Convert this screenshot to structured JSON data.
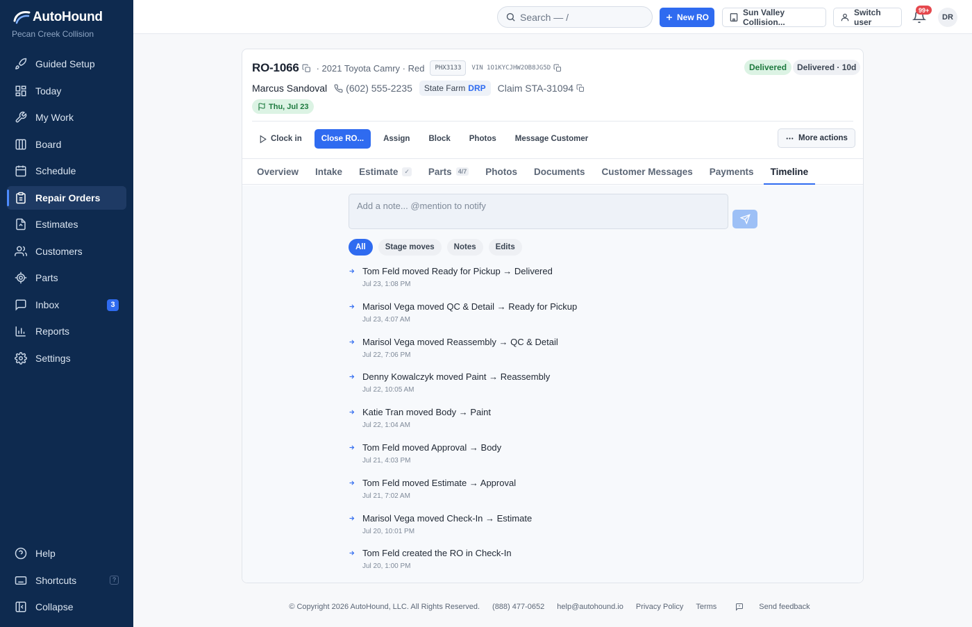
{
  "brand": {
    "name": "AutoHound",
    "shop": "Pecan Creek Collision"
  },
  "nav": {
    "items": [
      {
        "label": "Guided Setup",
        "icon": "rocket-icon"
      },
      {
        "label": "Today",
        "icon": "grid-icon"
      },
      {
        "label": "My Work",
        "icon": "wrench-icon"
      },
      {
        "label": "Board",
        "icon": "columns-icon"
      },
      {
        "label": "Schedule",
        "icon": "calendar-icon"
      },
      {
        "label": "Repair Orders",
        "icon": "clipboard-icon",
        "active": true
      },
      {
        "label": "Estimates",
        "icon": "file-icon"
      },
      {
        "label": "Customers",
        "icon": "users-icon"
      },
      {
        "label": "Parts",
        "icon": "cog-icon"
      },
      {
        "label": "Inbox",
        "icon": "inbox-icon",
        "badge": "3"
      },
      {
        "label": "Reports",
        "icon": "bar-chart-icon"
      },
      {
        "label": "Settings",
        "icon": "gear-icon"
      }
    ],
    "bottom": [
      {
        "label": "Help",
        "icon": "help-icon"
      },
      {
        "label": "Shortcuts",
        "icon": "keyboard-icon",
        "hint": "?"
      },
      {
        "label": "Collapse",
        "icon": "collapse-icon"
      }
    ]
  },
  "topbar": {
    "search_placeholder": "Search — /",
    "new_ro": "New RO",
    "location": "Sun Valley Collision...",
    "switch_user": "Switch user",
    "notifications": "99+",
    "avatar": "DR"
  },
  "ro": {
    "number": "RO-1066",
    "vehicle": "· 2021 Toyota Camry · Red",
    "plate": "PHX3133",
    "vin": "VIN 1O1KYCJHW2OB8JG5D",
    "status": "Delivered",
    "status_age": "Delivered · 10d",
    "customer": "Marcus Sandoval",
    "phone": "(602) 555-2235",
    "insurer": "State Farm",
    "insurer_tag": "DRP",
    "claim": "Claim STA-31094",
    "date": "Thu, Jul 23"
  },
  "actions": {
    "clock_in": "Clock in",
    "close_ro": "Close RO...",
    "assign": "Assign",
    "block": "Block",
    "photos": "Photos",
    "message": "Message Customer",
    "more": "More actions"
  },
  "tabs": [
    {
      "label": "Overview"
    },
    {
      "label": "Intake"
    },
    {
      "label": "Estimate",
      "extra": "✓"
    },
    {
      "label": "Parts",
      "extra": "4/7"
    },
    {
      "label": "Photos"
    },
    {
      "label": "Documents"
    },
    {
      "label": "Customer Messages"
    },
    {
      "label": "Payments"
    },
    {
      "label": "Timeline",
      "active": true
    }
  ],
  "timeline": {
    "note_placeholder": "Add a note... @mention to notify",
    "filters": [
      {
        "label": "All",
        "active": true
      },
      {
        "label": "Stage moves"
      },
      {
        "label": "Notes"
      },
      {
        "label": "Edits"
      }
    ],
    "events": [
      {
        "text": "Tom Feld moved Ready for Pickup → Delivered",
        "time": "Jul 23, 1:08 PM"
      },
      {
        "text": "Marisol Vega moved QC & Detail → Ready for Pickup",
        "time": "Jul 23, 4:07 AM"
      },
      {
        "text": "Marisol Vega moved Reassembly → QC & Detail",
        "time": "Jul 22, 7:06 PM"
      },
      {
        "text": "Denny Kowalczyk moved Paint → Reassembly",
        "time": "Jul 22, 10:05 AM"
      },
      {
        "text": "Katie Tran moved Body → Paint",
        "time": "Jul 22, 1:04 AM"
      },
      {
        "text": "Tom Feld moved Approval → Body",
        "time": "Jul 21, 4:03 PM"
      },
      {
        "text": "Tom Feld moved Estimate → Approval",
        "time": "Jul 21, 7:02 AM"
      },
      {
        "text": "Marisol Vega moved Check-In → Estimate",
        "time": "Jul 20, 10:01 PM"
      },
      {
        "text": "Tom Feld created the RO in Check-In",
        "time": "Jul 20, 1:00 PM"
      }
    ]
  },
  "footer": {
    "copyright": "© Copyright 2026 AutoHound, LLC. All Rights Reserved.",
    "phone": "(888) 477-0652",
    "email": "help@autohound.io",
    "privacy": "Privacy Policy",
    "terms": "Terms",
    "feedback": "Send feedback"
  }
}
